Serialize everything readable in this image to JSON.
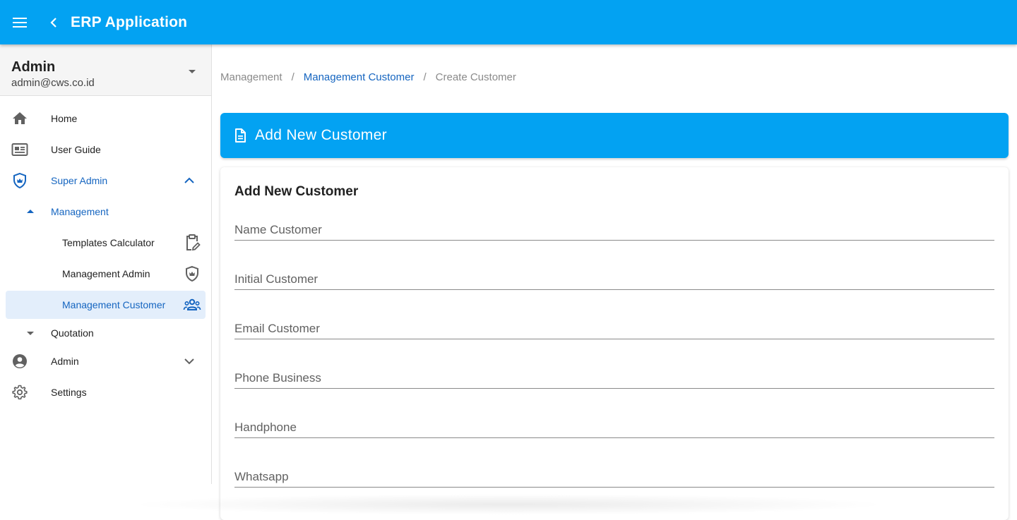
{
  "app": {
    "title": "ERP Application"
  },
  "colors": {
    "primary": "#03a2f2",
    "accent_text": "#1565c0",
    "selected_bg": "#e3eefb"
  },
  "profile": {
    "name": "Admin",
    "email": "admin@cws.co.id"
  },
  "sidebar": {
    "items": [
      {
        "label": "Home",
        "icon": "home-icon"
      },
      {
        "label": "User Guide",
        "icon": "user-guide-icon"
      },
      {
        "label": "Super Admin",
        "icon": "shield-icon",
        "expanded": true
      },
      {
        "label": "Management",
        "expanded": true
      },
      {
        "label": "Templates Calculator",
        "icon": "clipboard-edit-icon"
      },
      {
        "label": "Management Admin",
        "icon": "shield-icon"
      },
      {
        "label": "Management Customer",
        "icon": "people-icon",
        "selected": true
      },
      {
        "label": "Quotation",
        "expanded": false
      },
      {
        "label": "Admin",
        "icon": "account-circle-icon",
        "expanded": false
      },
      {
        "label": "Settings",
        "icon": "gear-icon"
      }
    ]
  },
  "breadcrumb": [
    "Management",
    "Management Customer",
    "Create Customer"
  ],
  "banner": {
    "title": "Add New Customer",
    "icon": "document-icon"
  },
  "form": {
    "title": "Add New Customer",
    "fields": [
      {
        "placeholder": "Name Customer",
        "value": ""
      },
      {
        "placeholder": "Initial Customer",
        "value": ""
      },
      {
        "placeholder": "Email Customer",
        "value": ""
      },
      {
        "placeholder": "Phone Business",
        "value": ""
      },
      {
        "placeholder": "Handphone",
        "value": ""
      },
      {
        "placeholder": "Whatsapp",
        "value": ""
      }
    ]
  }
}
